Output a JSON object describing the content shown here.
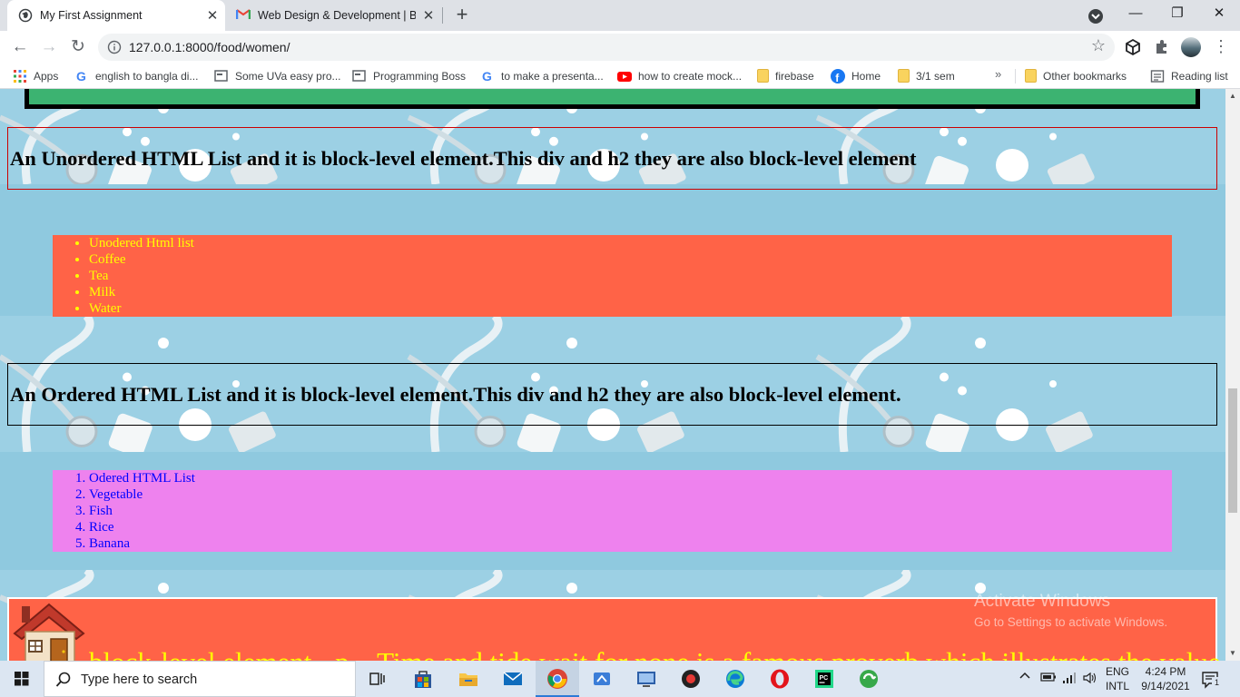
{
  "browser": {
    "tabs": [
      {
        "title": "My First Assignment"
      },
      {
        "title": "Web Design & Development | Ba"
      }
    ],
    "close_glyph": "✕",
    "new_tab_glyph": "+",
    "url": "127.0.0.1:8000/food/women/",
    "window_controls": {
      "minimize": "—",
      "restore": "❐",
      "close": "✕"
    }
  },
  "bookmarks": {
    "items": [
      {
        "label": "Apps",
        "icon": "apps-grid-icon"
      },
      {
        "label": "english to bangla di...",
        "icon": "google-icon"
      },
      {
        "label": "Some UVa easy pro...",
        "icon": "page-icon"
      },
      {
        "label": "Programming Boss",
        "icon": "page-icon"
      },
      {
        "label": "to make a presenta...",
        "icon": "google-icon"
      },
      {
        "label": "how to create mock...",
        "icon": "youtube-icon"
      },
      {
        "label": "firebase",
        "icon": "folder-icon"
      },
      {
        "label": "Home",
        "icon": "facebook-icon"
      },
      {
        "label": "3/1 sem",
        "icon": "folder-icon"
      }
    ],
    "more": "»",
    "other": "Other bookmarks",
    "reading_list": "Reading list"
  },
  "page": {
    "unordered_heading": "An Unordered HTML List and it is block-level element.This div and h2 they are also block-level element",
    "unordered_items": [
      "Unodered Html list",
      "Coffee",
      "Tea",
      "Milk",
      "Water"
    ],
    "ordered_heading": "An Ordered HTML List and it is block-level element.This div and h2 they are also block-level element.",
    "ordered_items": [
      "Odered HTML List",
      "Vegetable",
      "Fish",
      "Rice",
      "Banana"
    ],
    "footer_text": "block-level element - p... Time and tide wait for none is a famous proverb which illustrates the value",
    "colors": {
      "unordered_bg": "#ff6347",
      "unordered_text": "#ffff00",
      "ordered_bg": "#ee82ee",
      "ordered_text": "#0000ff",
      "green_box": "#3cb371",
      "page_bg": "#8fc9df"
    }
  },
  "activation": {
    "title": "Activate Windows",
    "subtitle": "Go to Settings to activate Windows."
  },
  "taskbar": {
    "search_placeholder": "Type here to search",
    "language": "ENG",
    "layout": "INTL",
    "time": "4:24 PM",
    "date": "9/14/2021",
    "notification_count": "1"
  }
}
